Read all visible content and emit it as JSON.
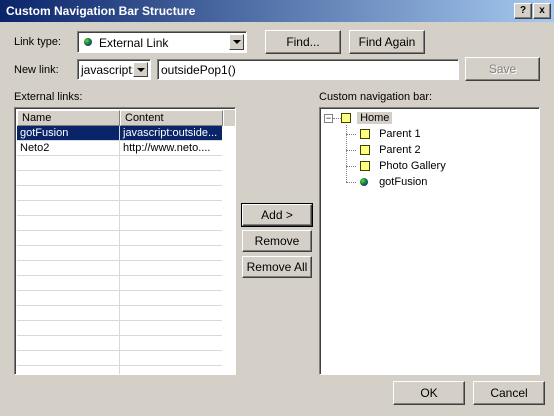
{
  "window": {
    "title": "Custom Navigation Bar Structure",
    "help_label": "?",
    "close_label": "x"
  },
  "form": {
    "link_type_label": "Link type:",
    "link_type_value": "External Link",
    "find_button": "Find...",
    "find_again_button": "Find Again",
    "new_link_label": "New link:",
    "protocol_value": "javascript:",
    "link_value": "outsidePop1()",
    "save_button": "Save"
  },
  "external_links": {
    "label": "External links:",
    "columns": [
      "Name",
      "Content"
    ],
    "rows": [
      {
        "name": "gotFusion",
        "content": "javascript:outside..."
      },
      {
        "name": "Neto2",
        "content": "http://www.neto...."
      }
    ]
  },
  "middle_buttons": {
    "add": "Add >",
    "remove": "Remove",
    "remove_all": "Remove All"
  },
  "nav_bar": {
    "label": "Custom navigation bar:",
    "root": "Home",
    "expander": "−",
    "children": [
      "Parent 1",
      "Parent 2",
      "Photo Gallery",
      "gotFusion"
    ]
  },
  "footer": {
    "ok": "OK",
    "cancel": "Cancel"
  },
  "colors": {
    "selection": "#0a246a",
    "dialog_bg": "#d4d0c8"
  }
}
